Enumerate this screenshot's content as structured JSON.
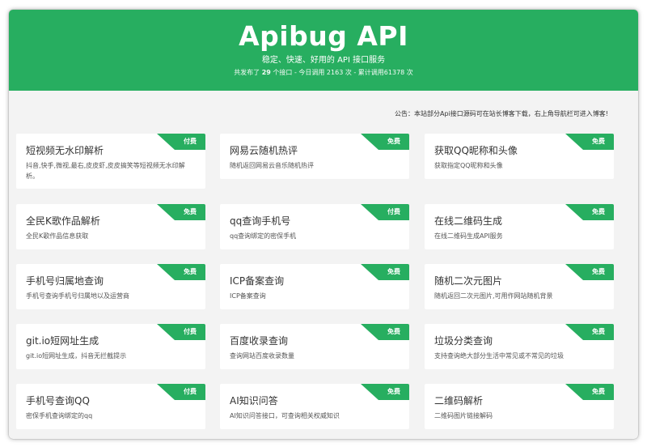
{
  "header": {
    "title": "Apibug API",
    "subtitle": "稳定、快速、好用的 API 接口服务",
    "stats_prefix": "共发布了 ",
    "api_count": "29",
    "stats_middle": " 个接口 - 今日调用 2163 次 - 累计调用61378 次"
  },
  "notice": "公告：本站部分Api接口源码可在站长博客下载，右上角导航栏可进入博客!",
  "colors": {
    "accent": "#27ae60",
    "page_background": "#f3f3f3",
    "card_background": "#ffffff"
  },
  "apis": [
    {
      "name": "短视频无水印解析",
      "desc": "抖音,快手,微视,最右,皮皮虾,皮皮搞笑等短视频无水印解析。",
      "tag": "付费"
    },
    {
      "name": "网易云随机热评",
      "desc": "随机返回网易云音乐随机热评",
      "tag": "免费"
    },
    {
      "name": "获取QQ昵称和头像",
      "desc": "获取指定QQ昵称和头像",
      "tag": "免费"
    },
    {
      "name": "全民K歌作品解析",
      "desc": "全民K歌作品信息获取",
      "tag": "免费"
    },
    {
      "name": "qq查询手机号",
      "desc": "qq查询绑定的密保手机",
      "tag": "付费"
    },
    {
      "name": "在线二维码生成",
      "desc": "在线二维码生成API服务",
      "tag": "免费"
    },
    {
      "name": "手机号归属地查询",
      "desc": "手机号查询手机号归属地以及运营商",
      "tag": "免费"
    },
    {
      "name": "ICP备案查询",
      "desc": "ICP备案查询",
      "tag": "免费"
    },
    {
      "name": "随机二次元图片",
      "desc": "随机返回二次元图片,可用作网站随机背景",
      "tag": "免费"
    },
    {
      "name": "git.io短网址生成",
      "desc": "git.io短网址生成，抖音无拦截提示",
      "tag": "付费"
    },
    {
      "name": "百度收录查询",
      "desc": "查询网站百度收录数量",
      "tag": "免费"
    },
    {
      "name": "垃圾分类查询",
      "desc": "支持查询绝大部分生活中常见或不常见的垃圾",
      "tag": "免费"
    },
    {
      "name": "手机号查询QQ",
      "desc": "密保手机查询绑定的qq",
      "tag": "付费"
    },
    {
      "name": "AI知识问答",
      "desc": "AI知识问答接口，可查询相关权威知识",
      "tag": "免费"
    },
    {
      "name": "二维码解析",
      "desc": "二维码图片链接解码",
      "tag": "免费"
    }
  ]
}
